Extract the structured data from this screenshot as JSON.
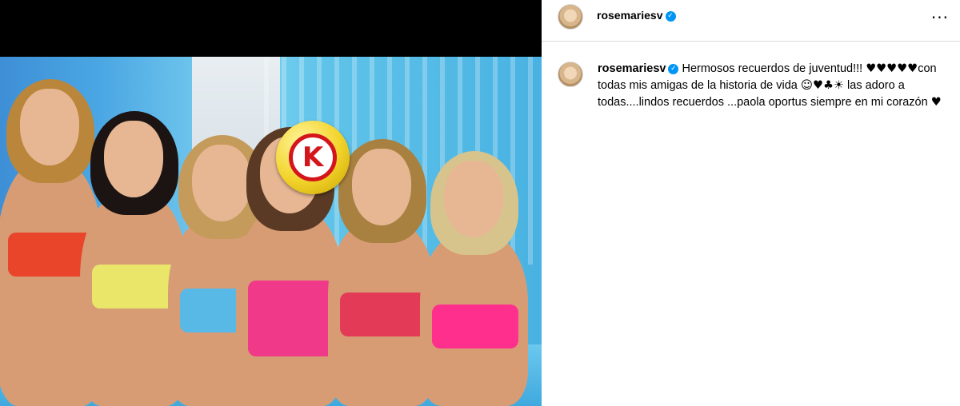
{
  "post": {
    "username": "rosemariesv",
    "verified_icon": "verified-badge-icon",
    "more_icon": "more-options-icon",
    "more_glyph": "···",
    "verified_glyph": "✓"
  },
  "caption": {
    "username": "rosemariesv",
    "text_1": "Hermosos recuerdos de juventud!!! ",
    "hearts": "♥♥♥♥♥",
    "text_2": "con todas mis amigas de la historia de vida ",
    "emojis": "☺♥♣☀",
    "text_3": " las adoro a todas....lindos recuerdos ...paola oportus siempre en mi corazón ",
    "heart_end": "♥"
  },
  "media": {
    "logo_letter": "K",
    "logo_icon": "circle-k-logo",
    "colors": {
      "tops": [
        "#e8452b",
        "#e9e66a",
        "#58b8e6",
        "#f03a89",
        "#e23a57",
        "#ff2f8d"
      ],
      "hair": [
        "#b9863b",
        "#1b1412",
        "#c59b5b",
        "#5a3a24",
        "#a8803f",
        "#d7c48d"
      ]
    }
  }
}
